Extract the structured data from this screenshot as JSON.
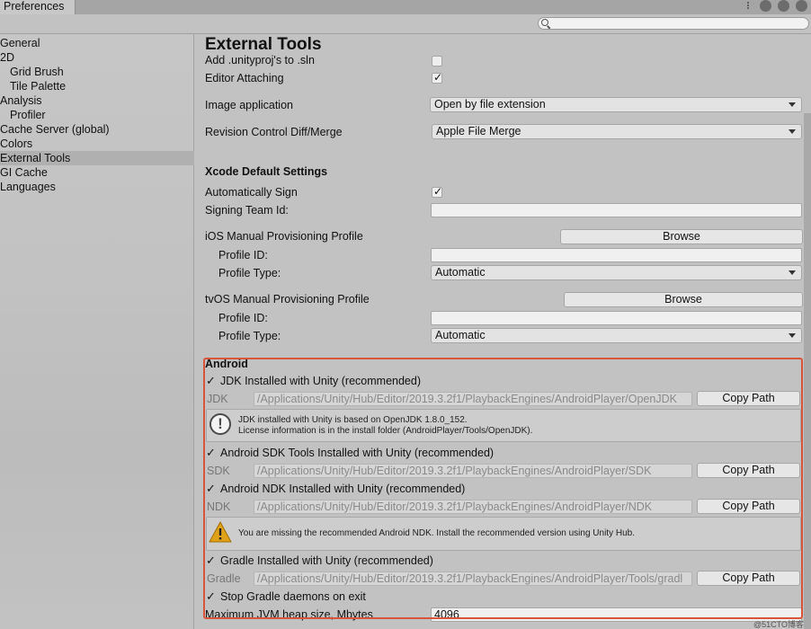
{
  "window": {
    "tab_title": "Preferences"
  },
  "sidebar": {
    "items": [
      {
        "label": "General"
      },
      {
        "label": "2D"
      },
      {
        "label": "Grid Brush"
      },
      {
        "label": "Tile Palette"
      },
      {
        "label": "Analysis"
      },
      {
        "label": "Profiler"
      },
      {
        "label": "Cache Server (global)"
      },
      {
        "label": "Colors"
      },
      {
        "label": "External Tools"
      },
      {
        "label": "GI Cache"
      },
      {
        "label": "Languages"
      }
    ]
  },
  "main": {
    "title": "External Tools",
    "add_unityproj_label": "Add .unityproj's to .sln",
    "editor_attaching_label": "Editor Attaching",
    "image_app_label": "Image application",
    "image_app_value": "Open by file extension",
    "revision_label": "Revision Control Diff/Merge",
    "revision_value": "Apple File Merge",
    "xcode_heading": "Xcode Default Settings",
    "auto_sign_label": "Automatically Sign",
    "signing_team_label": "Signing Team Id:",
    "ios_profile_label": "iOS Manual Provisioning Profile",
    "browse_label": "Browse",
    "profile_id_label": "Profile ID:",
    "profile_type_label": "Profile Type:",
    "profile_type_value": "Automatic",
    "tvos_profile_label": "tvOS Manual Provisioning Profile"
  },
  "android": {
    "heading": "Android",
    "jdk_check_label": "JDK Installed with Unity (recommended)",
    "jdk_label": "JDK",
    "jdk_path": "/Applications/Unity/Hub/Editor/2019.3.2f1/PlaybackEngines/AndroidPlayer/OpenJDK",
    "copy_path_label": "Copy Path",
    "jdk_info_line1": "JDK installed with Unity is based on OpenJDK 1.8.0_152.",
    "jdk_info_line2": "License information is in the install folder (AndroidPlayer/Tools/OpenJDK).",
    "sdk_check_label": "Android SDK Tools Installed with Unity (recommended)",
    "sdk_label": "SDK",
    "sdk_path": "/Applications/Unity/Hub/Editor/2019.3.2f1/PlaybackEngines/AndroidPlayer/SDK",
    "ndk_check_label": "Android NDK Installed with Unity (recommended)",
    "ndk_label": "NDK",
    "ndk_path": "/Applications/Unity/Hub/Editor/2019.3.2f1/PlaybackEngines/AndroidPlayer/NDK",
    "ndk_warning": "You are missing the recommended Android NDK. Install the recommended version using Unity Hub.",
    "gradle_check_label": "Gradle Installed with Unity (recommended)",
    "gradle_label": "Gradle",
    "gradle_path": "/Applications/Unity/Hub/Editor/2019.3.2f1/PlaybackEngines/AndroidPlayer/Tools/gradl",
    "stop_gradle_label": "Stop Gradle daemons on exit",
    "jvm_heap_label": "Maximum JVM heap size, Mbytes",
    "jvm_heap_value": "4096"
  },
  "watermark": "@51CTO博客",
  "colors": {
    "highlight": "#d9553a",
    "selected_row": "#b0b0b0",
    "background": "#c2c2c2"
  }
}
